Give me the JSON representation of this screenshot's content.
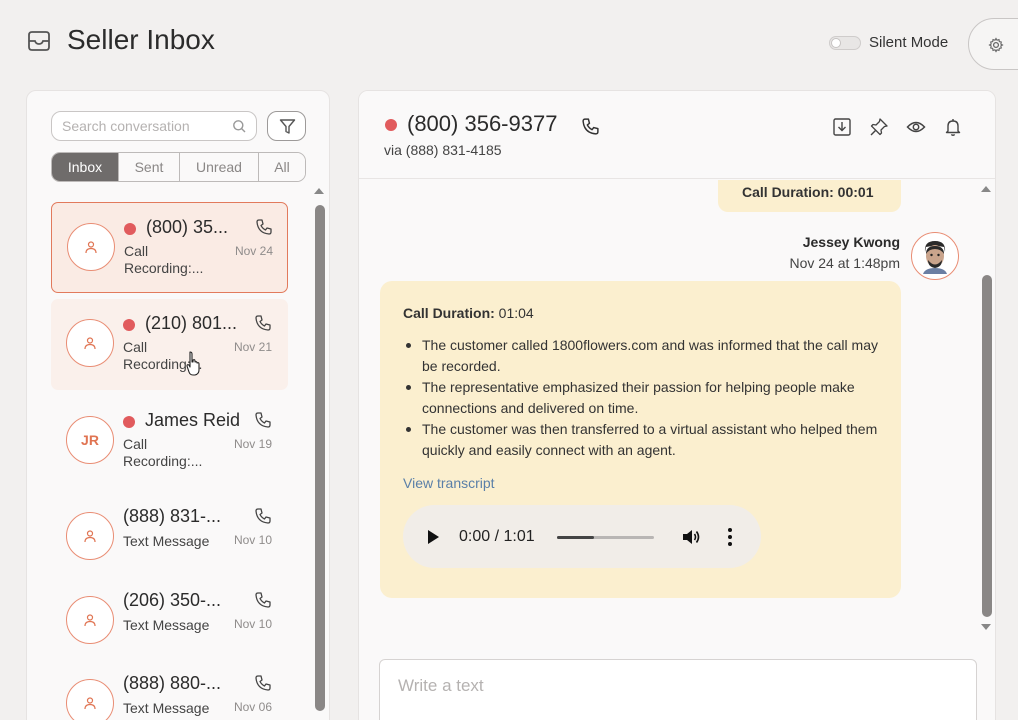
{
  "header": {
    "title": "Seller Inbox",
    "silent_mode_label": "Silent Mode",
    "silent_mode_on": false
  },
  "sidebar": {
    "search_placeholder": "Search conversation",
    "tabs": [
      {
        "label": "Inbox",
        "active": true
      },
      {
        "label": "Sent",
        "active": false
      },
      {
        "label": "Unread",
        "active": false
      },
      {
        "label": "All",
        "active": false
      }
    ],
    "conversations": [
      {
        "name": "(800) 35...",
        "unread": true,
        "subtitle": "Call Recording:...",
        "date": "Nov 24",
        "avatar": "person-icon",
        "selected": true
      },
      {
        "name": "(210) 801...",
        "unread": true,
        "subtitle": "Call Recording:...",
        "date": "Nov 21",
        "avatar": "person-icon",
        "selected": false
      },
      {
        "name": "James Reid",
        "unread": true,
        "subtitle": "Call Recording:...",
        "date": "Nov 19",
        "avatar_initials": "JR",
        "selected": false
      },
      {
        "name": "(888) 831-...",
        "unread": false,
        "subtitle": "Text Message",
        "date": "Nov 10",
        "avatar": "person-icon",
        "selected": false
      },
      {
        "name": "(206) 350-...",
        "unread": false,
        "subtitle": "Text Message",
        "date": "Nov 10",
        "avatar": "person-icon",
        "selected": false
      },
      {
        "name": "(888) 880-...",
        "unread": false,
        "subtitle": "Text Message",
        "date": "Nov 06",
        "avatar": "person-icon",
        "selected": false
      }
    ]
  },
  "chat": {
    "phone": "(800) 356-9377",
    "via": "via (888) 831-4185",
    "header_icons": [
      "download-icon",
      "pin-icon",
      "eye-icon",
      "bell-icon"
    ],
    "previous_message": "Call Duration: 00:01",
    "sender_name": "Jessey Kwong",
    "sender_time": "Nov 24 at 1:48pm",
    "message": {
      "duration_label": "Call Duration:",
      "duration_value": "01:04",
      "bullets": [
        "The customer called 1800flowers.com and was informed that the call may be recorded.",
        "The representative emphasized their passion for helping people make connections and delivered on time.",
        "The customer was then transferred to a virtual assistant who helped them quickly and easily connect with an agent."
      ],
      "transcript_link": "View transcript",
      "audio_time": "0:00 / 1:01",
      "audio_progress": 0.38
    },
    "compose_placeholder": "Write a text"
  },
  "colors": {
    "accent": "#e27a5c",
    "unread_dot": "#e15b5d",
    "bubble": "#fbefcf",
    "active_tab": "#6f6c6b",
    "link": "#5a7fa8"
  }
}
